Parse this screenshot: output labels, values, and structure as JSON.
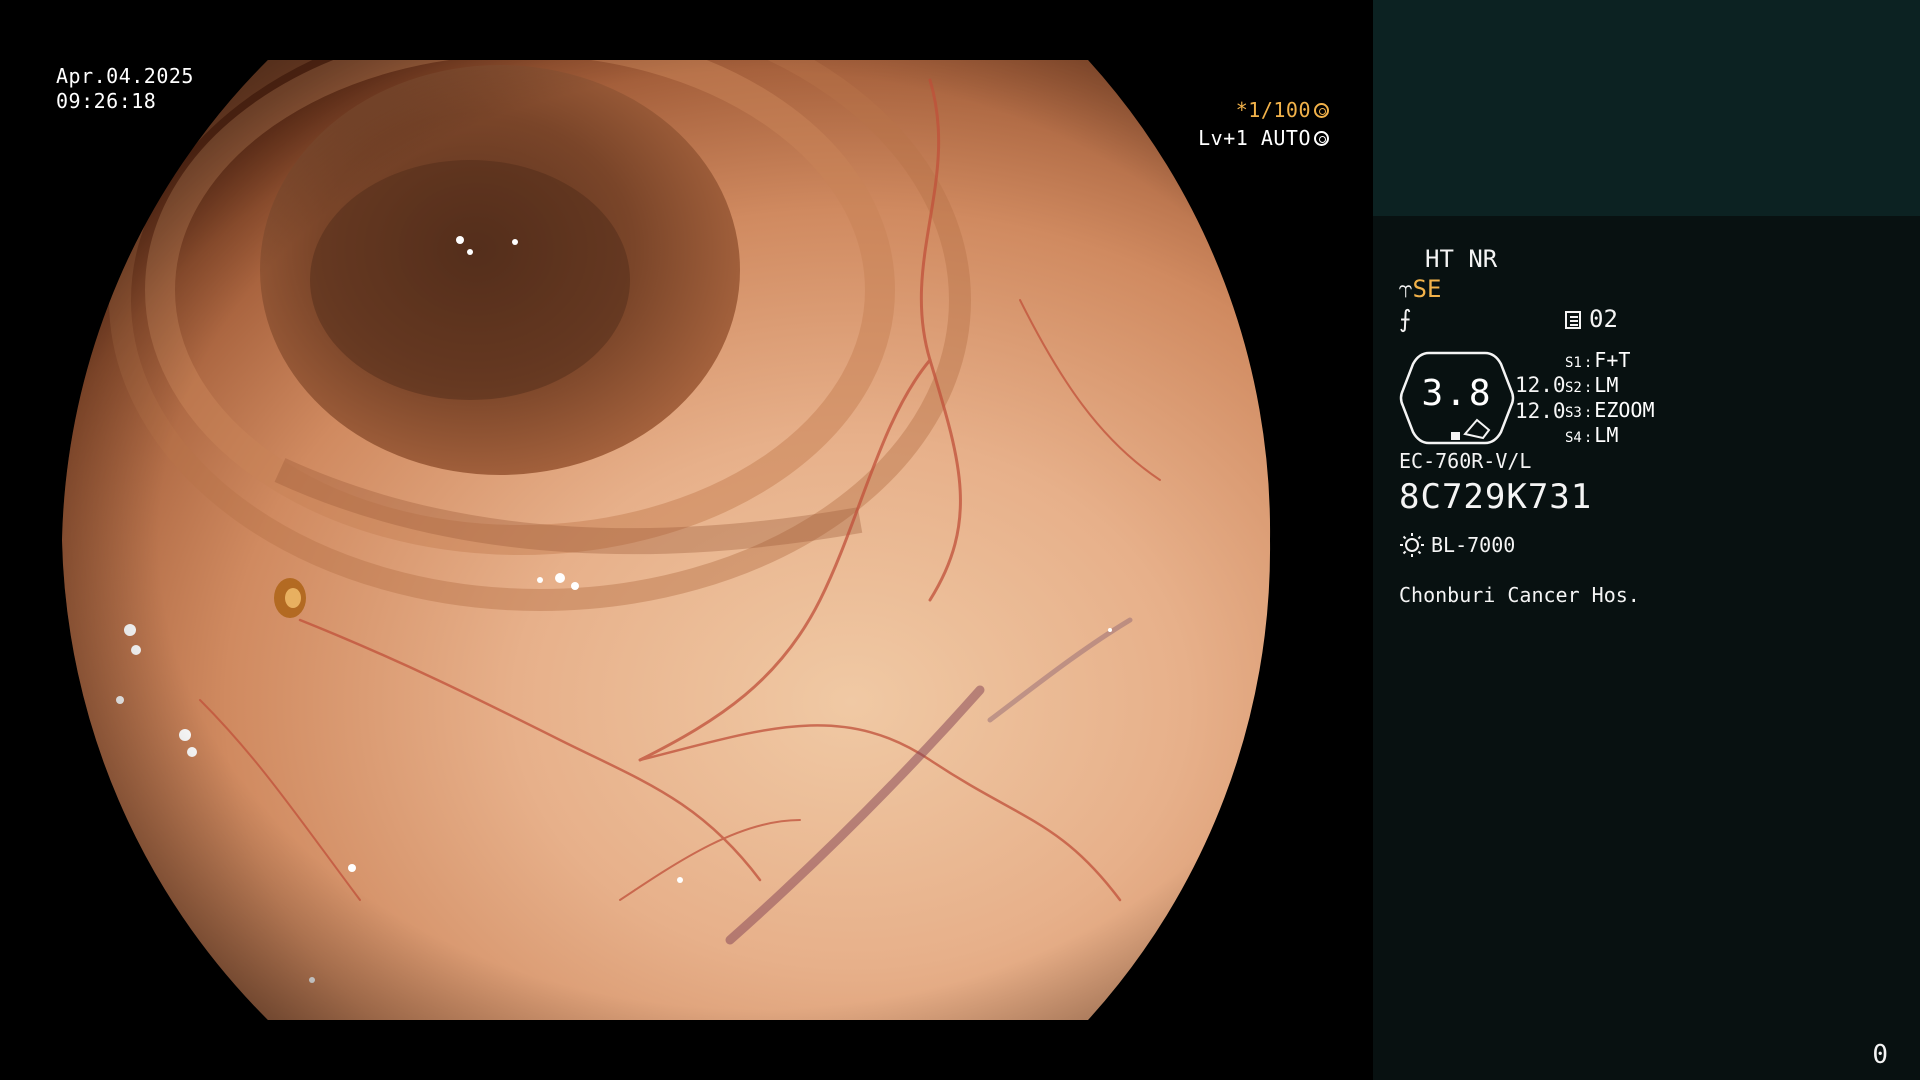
{
  "overlay": {
    "date": "Apr.04.2025",
    "time": "09:26:18",
    "shutter": "*1/100",
    "iris_level": "Lv+1 AUTO"
  },
  "panel": {
    "ht_nr": "HT NR",
    "color_mode_symbol": "⥾",
    "color_mode": "SE",
    "enhance_symbol": "⨍",
    "memory_icon": "memory-card-icon",
    "memory_number": "02",
    "hex_value": "3.8",
    "value_1": "12.0",
    "value_2": "12.0",
    "switches": [
      {
        "key": "S1",
        "value": "F+T"
      },
      {
        "key": "S2",
        "value": "LM"
      },
      {
        "key": "S3",
        "value": "EZOOM"
      },
      {
        "key": "S4",
        "value": "LM"
      }
    ],
    "scope_model": "EC-760R-V/L",
    "scope_serial": "8C729K731",
    "light_icon": "sun-icon",
    "light_source": "BL-7000",
    "hospital": "Chonburi Cancer Hos.",
    "counter": "0"
  },
  "colors": {
    "panel_bg": "#081111",
    "thumb_bg": "#0c2222",
    "accent_orange": "#f2b24a",
    "tissue_light": "#e9b98f",
    "tissue_dark": "#6e3a22"
  }
}
